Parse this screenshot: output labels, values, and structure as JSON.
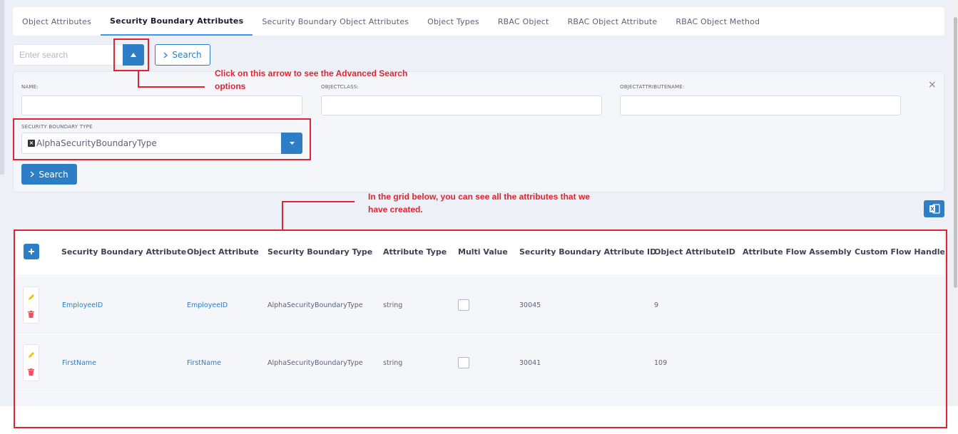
{
  "tabs": [
    {
      "label": "Object Attributes",
      "active": false
    },
    {
      "label": "Security Boundary Attributes",
      "active": true
    },
    {
      "label": "Security Boundary Object Attributes",
      "active": false
    },
    {
      "label": "Object Types",
      "active": false
    },
    {
      "label": "RBAC Object",
      "active": false
    },
    {
      "label": "RBAC Object Attribute",
      "active": false
    },
    {
      "label": "RBAC Object Method",
      "active": false
    }
  ],
  "search": {
    "placeholder": "Enter search",
    "button_label": "Search"
  },
  "advanced": {
    "name_label": "NAME:",
    "objectclass_label": "OBJECTCLASS:",
    "objectattributename_label": "OBJECTATTRIBUTENAME:",
    "sbt_label": "SECURITY BOUNDARY TYPE",
    "sbt_value": "AlphaSecurityBoundaryType",
    "search_button": "Search",
    "close_glyph": "×"
  },
  "annotations": {
    "arrow_note_1": "Click on this arrow to see the Advanced Search",
    "arrow_note_2": "options",
    "grid_note_1": "In the grid below, you can see all the attributes that we",
    "grid_note_2": "have created."
  },
  "grid": {
    "columns": [
      "Security Boundary Attribute",
      "Object Attribute",
      "Security Boundary Type",
      "Attribute Type",
      "Multi Value",
      "Security Boundary Attribute ID",
      "Object AttributeID",
      "Attribute Flow Assembly",
      "Custom Flow Handler"
    ],
    "rows": [
      {
        "security_boundary_attribute": "EmployeeID",
        "object_attribute": "EmployeeID",
        "security_boundary_type": "AlphaSecurityBoundaryType",
        "attribute_type": "string",
        "multi_value": false,
        "sba_id": "30045",
        "object_attribute_id": "9"
      },
      {
        "security_boundary_attribute": "FirstName",
        "object_attribute": "FirstName",
        "security_boundary_type": "AlphaSecurityBoundaryType",
        "attribute_type": "string",
        "multi_value": false,
        "sba_id": "30041",
        "object_attribute_id": "109"
      }
    ]
  },
  "icons": {
    "arrow_up": "caret-up-icon",
    "chevron_right": "chevron-right-icon",
    "caret_down": "caret-down-icon",
    "plus": "plus-icon",
    "edit": "pencil-icon",
    "delete": "trash-icon",
    "excel": "excel-icon",
    "close": "close-icon"
  },
  "colors": {
    "primary": "#2e7ec7",
    "annotation_red": "#e02432",
    "edit_icon": "#f6c000",
    "delete_icon": "#f64e60"
  }
}
